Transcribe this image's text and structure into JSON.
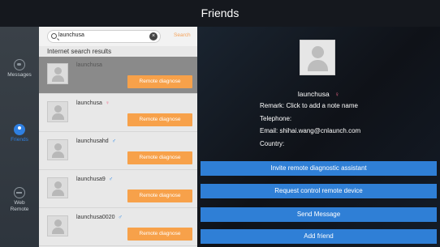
{
  "header": {
    "title": "Friends"
  },
  "rail": {
    "items": [
      {
        "label": "Messages",
        "icon": "message-icon"
      },
      {
        "label": "Friends",
        "icon": "friends-icon"
      },
      {
        "label": "Web Remote",
        "icon": "web-remote-icon"
      }
    ]
  },
  "search": {
    "value": "launchusa",
    "action_label": "Search"
  },
  "list": {
    "section_label": "Internet search results",
    "button_label": "Remote diagnose",
    "rows": [
      {
        "name": "launchusa",
        "gender": ""
      },
      {
        "name": "launchusa",
        "gender": "♀"
      },
      {
        "name": "launchusahd",
        "gender": "♂"
      },
      {
        "name": "launchusa9",
        "gender": "♂"
      },
      {
        "name": "launchusa0020",
        "gender": "♂"
      }
    ]
  },
  "detail": {
    "name": "launchusa",
    "gender": "♀",
    "remark_label": "Remark:",
    "remark_value": "Click to add a note name",
    "telephone_label": "Telephone:",
    "telephone_value": "",
    "email_label": "Email:",
    "email_value": "shihai.wang@cnlaunch.com",
    "country_label": "Country:",
    "country_value": ""
  },
  "actions": {
    "invite": "Invite remote diagnostic assistant",
    "request": "Request control remote device",
    "message": "Send Message",
    "add": "Add friend"
  },
  "colors": {
    "accent_blue": "#2f7fd6",
    "diagnose_orange": "#f7a14a",
    "female": "#f06a8a",
    "male": "#3a8fe6"
  }
}
